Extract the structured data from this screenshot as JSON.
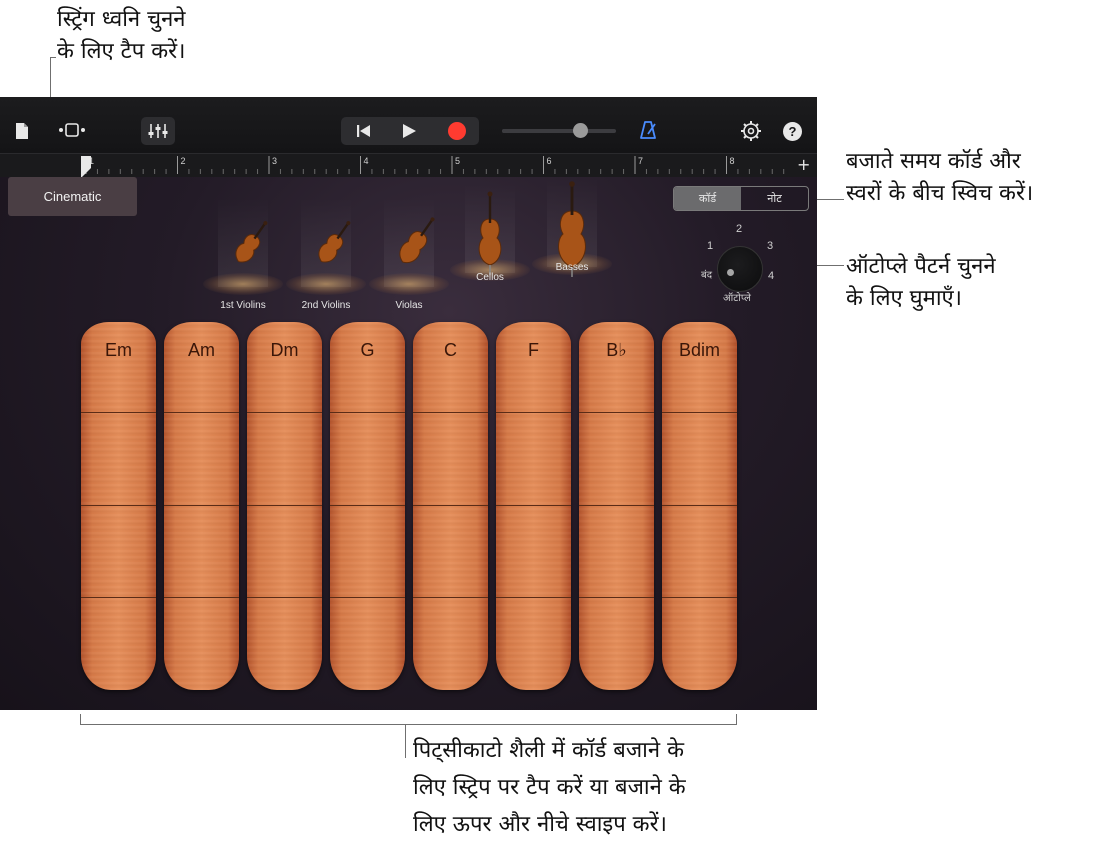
{
  "annotations": {
    "tap_sound_line1": "स्ट्रिंग ध्वनि चुनने",
    "tap_sound_line2": "के लिए टैप करें।",
    "switch_line1": "बजाते समय कॉर्ड और",
    "switch_line2": "स्वरों के बीच स्विच करें।",
    "autoplay_line1": "ऑटोप्ले पैटर्न चुनने",
    "autoplay_line2": "के लिए घुमाएँ।",
    "strips_line1": "पिट्सीकाटो शैली में कॉर्ड बजाने के",
    "strips_line2": "लिए स्ट्रिप पर टैप करें या बजाने के",
    "strips_line3": "लिए ऊपर और नीचे स्वाइप करें।"
  },
  "toolbar": {
    "icons": [
      "document-icon",
      "tracks-view-icon",
      "mixer-icon",
      "go-to-start-icon",
      "play-icon",
      "record-icon",
      "master-volume-slider",
      "metronome-icon",
      "settings-icon",
      "help-icon"
    ],
    "help_label": "?",
    "record_color": "#ff3b30",
    "metronome_color": "#4a8cff",
    "volume_level": 0.72
  },
  "ruler": {
    "bars": [
      "1",
      "2",
      "3",
      "4",
      "5",
      "6",
      "7",
      "8"
    ],
    "add_label": "+"
  },
  "preset": {
    "label": "Cinematic"
  },
  "mode_switch": {
    "chords": "कॉर्ड",
    "notes": "नोट",
    "selected": "chords"
  },
  "instruments": [
    {
      "name": "1st Violins"
    },
    {
      "name": "2nd Violins"
    },
    {
      "name": "Violas"
    },
    {
      "name": "Cellos"
    },
    {
      "name": "Basses"
    }
  ],
  "autoplay": {
    "label": "ऑटोप्ले",
    "off": "बंद",
    "positions": [
      "1",
      "2",
      "3",
      "4"
    ],
    "selected": "off"
  },
  "chord_strips": [
    {
      "chord": "Em"
    },
    {
      "chord": "Am"
    },
    {
      "chord": "Dm"
    },
    {
      "chord": "G"
    },
    {
      "chord": "C"
    },
    {
      "chord": "F"
    },
    {
      "chord": "B♭"
    },
    {
      "chord": "Bdim"
    }
  ],
  "colors": {
    "strip_wood": "#e58e5a",
    "chord_text": "#3a1608",
    "background": "#231b27"
  }
}
